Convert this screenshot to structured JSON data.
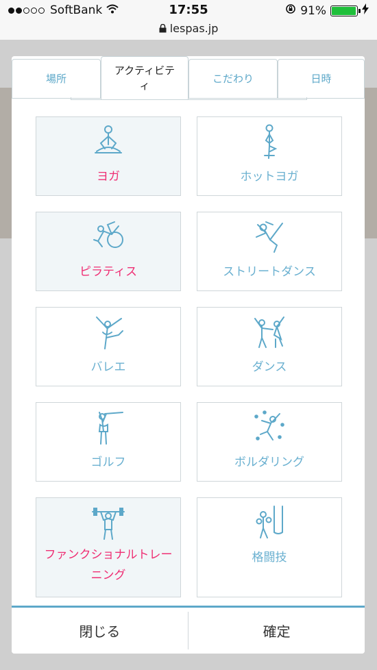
{
  "status_bar": {
    "carrier": "SoftBank",
    "time": "17:55",
    "battery": "91%",
    "battery_level": 0.91,
    "signal_bars": 2
  },
  "browser": {
    "url": "lespas.jp"
  },
  "tabs": [
    {
      "label": "場所"
    },
    {
      "label": "アクティビテ ィ"
    },
    {
      "label": "こだわり"
    },
    {
      "label": "日時"
    }
  ],
  "activities": [
    {
      "label": "ヨガ",
      "icon": "yoga-lotus-icon",
      "selected": true
    },
    {
      "label": "ホットヨガ",
      "icon": "hot-yoga-tree-pose-icon",
      "selected": false
    },
    {
      "label": "ピラティス",
      "icon": "pilates-ball-icon",
      "selected": true
    },
    {
      "label": "ストリートダンス",
      "icon": "street-dance-icon",
      "selected": false
    },
    {
      "label": "バレエ",
      "icon": "ballet-icon",
      "selected": false
    },
    {
      "label": "ダンス",
      "icon": "couple-dance-icon",
      "selected": false
    },
    {
      "label": "ゴルフ",
      "icon": "golf-swing-icon",
      "selected": false
    },
    {
      "label": "ボルダリング",
      "icon": "bouldering-icon",
      "selected": false
    },
    {
      "label": "ファンクショナルトレーニング",
      "icon": "barbell-training-icon",
      "selected": true
    },
    {
      "label": "格闘技",
      "icon": "boxing-bag-icon",
      "selected": false
    }
  ],
  "footer": {
    "close_label": "閉じる",
    "confirm_label": "確定"
  },
  "colors": {
    "accent": "#5da8c9",
    "selected_text": "#ef2f74",
    "selected_bg": "#f1f6f8"
  }
}
